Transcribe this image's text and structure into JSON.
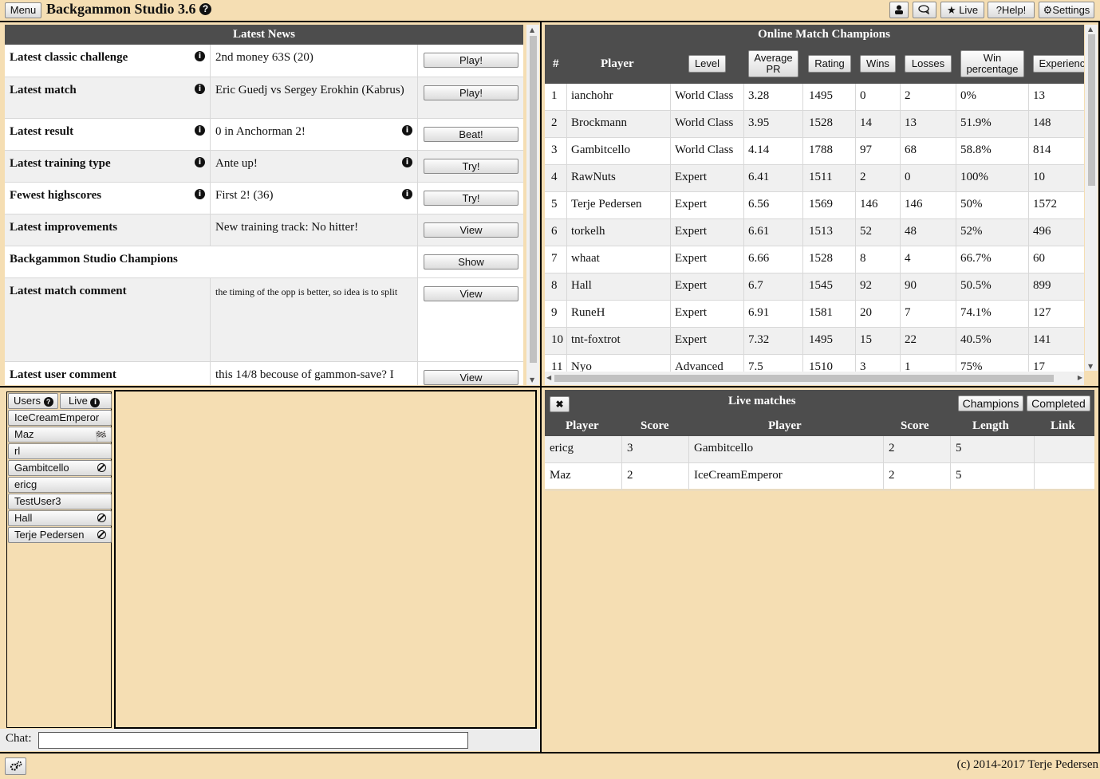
{
  "topbar": {
    "menu_label": "Menu",
    "app_title": "Backgammon Studio 3.6",
    "help_glyph": "?",
    "buttons": {
      "user_glyph": "👤",
      "chat_glyph": "🗨",
      "live_label": "★ Live",
      "help_label": "?Help!",
      "settings_label": "⚙Settings"
    }
  },
  "news": {
    "title": "Latest News",
    "rows": [
      {
        "label": "Latest classic challenge",
        "value": "2nd money 63S (20)",
        "button": "Play!"
      },
      {
        "label": "Latest match",
        "value": "Eric Guedj vs Sergey Erokhin (Kabrus)",
        "button": "Play!"
      },
      {
        "label": "Latest result",
        "value": "0 in Anchorman 2!",
        "button": "Beat!"
      },
      {
        "label": "Latest training type",
        "value": "Ante up!",
        "button": "Try!"
      },
      {
        "label": "Fewest highscores",
        "value": "First 2! (36)",
        "button": "Try!"
      },
      {
        "label": "Latest improvements",
        "value": "New training track: No hitter!",
        "button": "View"
      },
      {
        "label": "Backgammon Studio Champions",
        "value": "",
        "button": "Show"
      },
      {
        "label": "Latest match comment",
        "value": "the timing of the opp is better, so idea is to split",
        "button": "View"
      },
      {
        "label": "Latest user comment",
        "value": "this 14/8 becouse of gammon-save? I",
        "button": "View"
      }
    ]
  },
  "champions": {
    "title": "Online Match Champions",
    "headers": {
      "num": "#",
      "player": "Player",
      "level": "Level",
      "avg_pr": "Average PR",
      "rating": "Rating",
      "wins": "Wins",
      "losses": "Losses",
      "win_pct": "Win percentage",
      "experience": "Experience"
    },
    "rows": [
      [
        "1",
        "ianchohr",
        "World Class",
        "3.28",
        "1495",
        "0",
        "2",
        "0%",
        "13"
      ],
      [
        "2",
        "Brockmann",
        "World Class",
        "3.95",
        "1528",
        "14",
        "13",
        "51.9%",
        "148"
      ],
      [
        "3",
        "Gambitcello",
        "World Class",
        "4.14",
        "1788",
        "97",
        "68",
        "58.8%",
        "814"
      ],
      [
        "4",
        "RawNuts",
        "Expert",
        "6.41",
        "1511",
        "2",
        "0",
        "100%",
        "10"
      ],
      [
        "5",
        "Terje Pedersen",
        "Expert",
        "6.56",
        "1569",
        "146",
        "146",
        "50%",
        "1572"
      ],
      [
        "6",
        "torkelh",
        "Expert",
        "6.61",
        "1513",
        "52",
        "48",
        "52%",
        "496"
      ],
      [
        "7",
        "whaat",
        "Expert",
        "6.66",
        "1528",
        "8",
        "4",
        "66.7%",
        "60"
      ],
      [
        "8",
        "Hall",
        "Expert",
        "6.7",
        "1545",
        "92",
        "90",
        "50.5%",
        "899"
      ],
      [
        "9",
        "RuneH",
        "Expert",
        "6.91",
        "1581",
        "20",
        "7",
        "74.1%",
        "127"
      ],
      [
        "10",
        "tnt-foxtrot",
        "Expert",
        "7.32",
        "1495",
        "15",
        "22",
        "40.5%",
        "141"
      ],
      [
        "11",
        "Nyo",
        "Advanced",
        "7.5",
        "1510",
        "3",
        "1",
        "75%",
        "17"
      ]
    ]
  },
  "users": {
    "tab_users": "Users",
    "tab_live": "Live",
    "list": [
      {
        "name": "IceCreamEmperor",
        "icon": ""
      },
      {
        "name": "Maz",
        "icon": "flag-icon"
      },
      {
        "name": "rl",
        "icon": ""
      },
      {
        "name": "Gambitcello",
        "icon": "busy-icon"
      },
      {
        "name": "ericg",
        "icon": ""
      },
      {
        "name": "TestUser3",
        "icon": ""
      },
      {
        "name": "Hall",
        "icon": "busy-icon"
      },
      {
        "name": "Terje Pedersen",
        "icon": "busy-icon"
      }
    ]
  },
  "chat": {
    "label": "Chat:",
    "input_value": ""
  },
  "live_matches": {
    "title": "Live matches",
    "close_glyph": "✖",
    "champions_btn": "Champions",
    "completed_btn": "Completed",
    "headers": {
      "player1": "Player",
      "score1": "Score",
      "player2": "Player",
      "score2": "Score",
      "length": "Length",
      "link": "Link"
    },
    "rows": [
      [
        "ericg",
        "3",
        "Gambitcello",
        "2",
        "5",
        ""
      ],
      [
        "Maz",
        "2",
        "IceCreamEmperor",
        "2",
        "5",
        ""
      ]
    ]
  },
  "footer": {
    "copyright": "(c) 2014-2017 Terje Pedersen"
  }
}
